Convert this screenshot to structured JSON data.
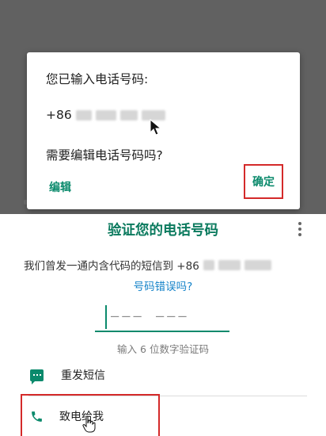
{
  "dialog": {
    "title": "您已输入电话号码:",
    "country_code": "+86",
    "question": "需要编辑电话号码吗?",
    "edit_label": "编辑",
    "ok_label": "确定"
  },
  "verify": {
    "title": "验证您的电话号码",
    "sms_text": "我们曾发一通内含代码的短信到 +86",
    "wrong_number": "号码错误吗?",
    "code_placeholder": "——— ———",
    "code_hint": "输入 6 位数字验证码",
    "resend_label": "重发短信",
    "call_label": "致电给我"
  },
  "icons": {
    "menu": "more-vert-icon",
    "resend": "chat-icon",
    "call": "phone-icon",
    "pointer": "arrow-cursor-icon",
    "hand": "hand-cursor-icon"
  },
  "colors": {
    "accent": "#0b8a6c",
    "title": "#0b7a5e",
    "link": "#1583c9",
    "highlight_box": "#d42a2a",
    "overlay": "#616161"
  }
}
